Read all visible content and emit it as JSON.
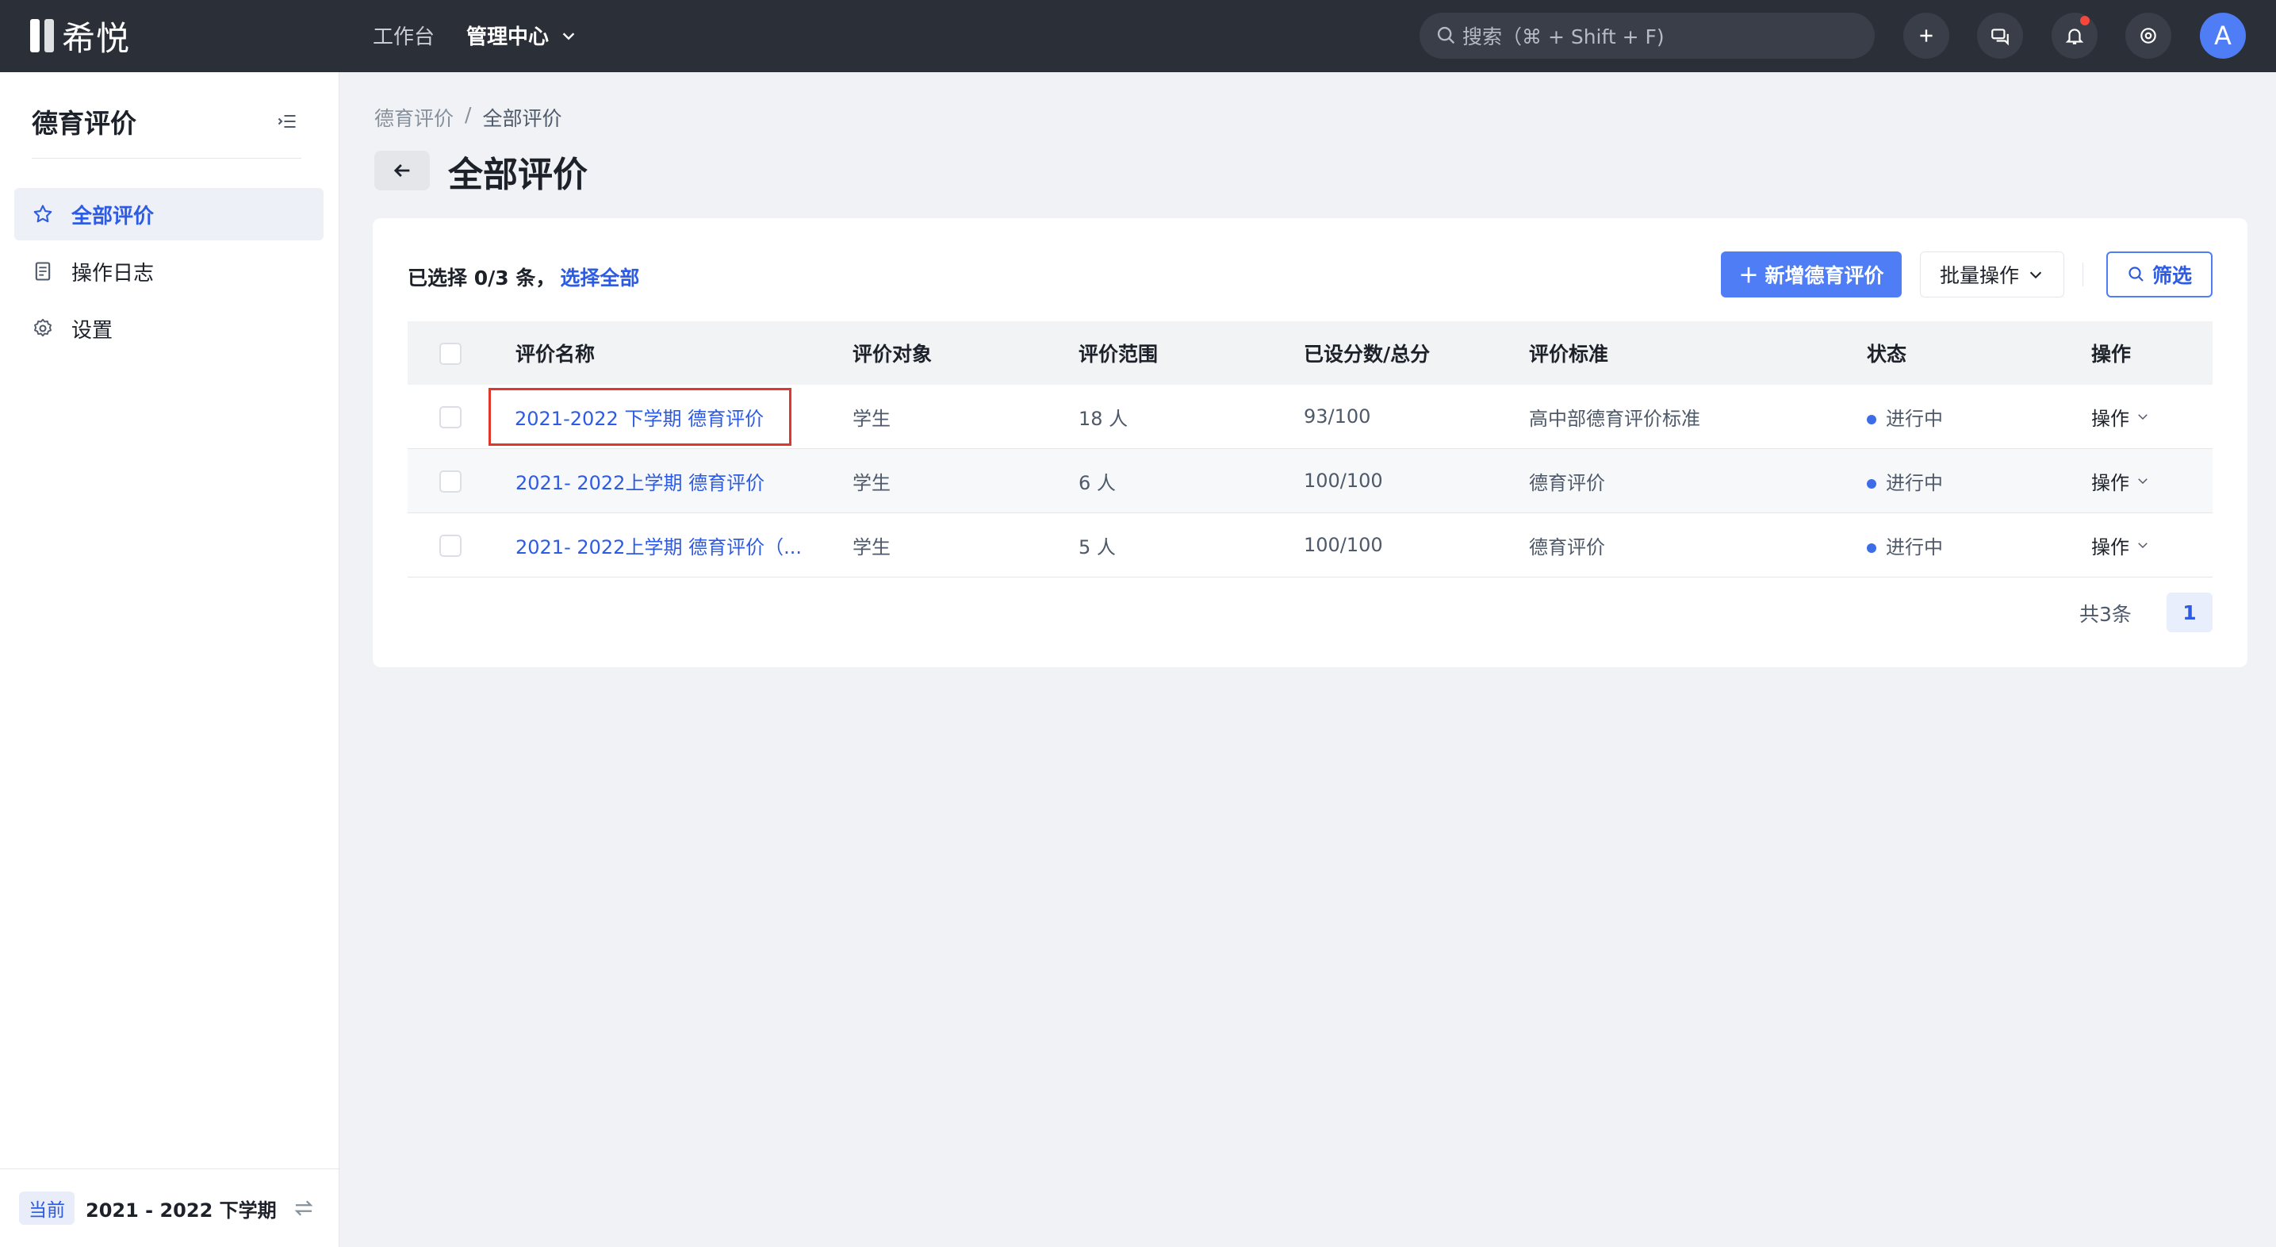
{
  "topbar": {
    "logo_text": "希悦",
    "nav": {
      "workbench": "工作台",
      "admin": "管理中心"
    },
    "search_placeholder": "搜索（⌘ + Shift + F)",
    "avatar_letter": "A",
    "icons": [
      "search-icon",
      "plus-icon",
      "chat-icon",
      "bell-icon",
      "settings-icon",
      "chevron-down-icon"
    ],
    "notification_dot_color": "#f5473b"
  },
  "sidebar": {
    "title": "德育评价",
    "items": [
      {
        "label": "全部评价",
        "icon": "star-icon",
        "active": true
      },
      {
        "label": "操作日志",
        "icon": "document-icon",
        "active": false
      },
      {
        "label": "设置",
        "icon": "gear-icon",
        "active": false
      }
    ],
    "footer": {
      "badge": "当前",
      "term": "2021 - 2022 下学期"
    }
  },
  "breadcrumb": {
    "parent": "德育评价",
    "separator": "/",
    "current": "全部评价"
  },
  "page_title": "全部评价",
  "toolbar": {
    "selected_text": "已选择 0/3 条，",
    "select_all": "选择全部",
    "add_button": "新增德育评价",
    "batch_button": "批量操作",
    "filter_button": "筛选"
  },
  "table": {
    "columns": [
      "评价名称",
      "评价对象",
      "评价范围",
      "已设分数/总分",
      "评价标准",
      "状态",
      "操作"
    ],
    "rows": [
      {
        "name": "2021-2022 下学期 德育评价",
        "target": "学生",
        "scope": "18 人",
        "score": "93/100",
        "standard": "高中部德育评价标准",
        "status": "进行中",
        "action": "操作",
        "highlighted": true
      },
      {
        "name": "2021- 2022上学期 德育评价",
        "target": "学生",
        "scope": "6 人",
        "score": "100/100",
        "standard": "德育评价",
        "status": "进行中",
        "action": "操作",
        "highlighted": false
      },
      {
        "name": "2021- 2022上学期 德育评价（...",
        "target": "学生",
        "scope": "5 人",
        "score": "100/100",
        "standard": "德育评价",
        "status": "进行中",
        "action": "操作",
        "highlighted": false
      }
    ]
  },
  "pagination": {
    "total": "共3条",
    "page": "1"
  },
  "colors": {
    "accent": "#4e7df6",
    "link": "#2d5be3",
    "topbar": "#2b2f38",
    "highlight_border": "#e0372d"
  }
}
